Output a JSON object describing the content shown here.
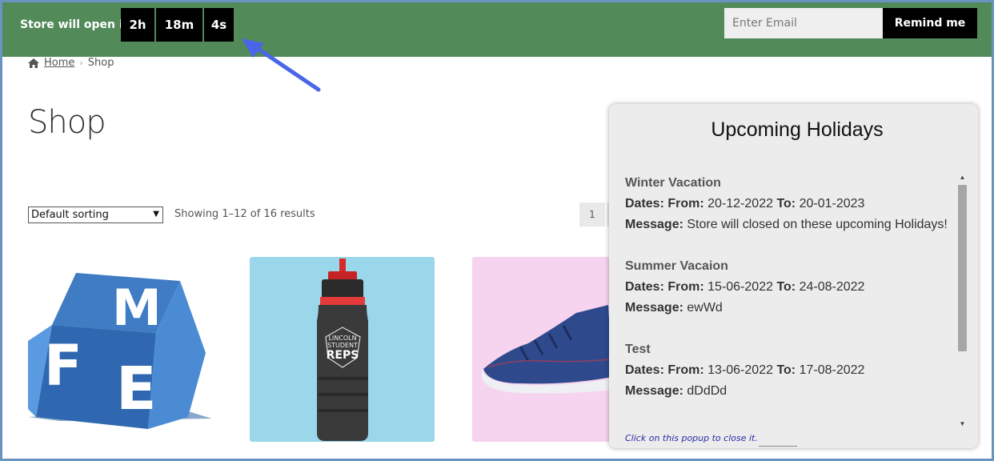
{
  "topbar": {
    "countdown_label": "Store will open in",
    "hours": "2h",
    "minutes": "18m",
    "seconds": "4s",
    "email_placeholder": "Enter Email",
    "remind_label": "Remind me",
    "bg_color": "#528a59"
  },
  "breadcrumb": {
    "home": "Home",
    "current": "Shop"
  },
  "page": {
    "title": "Shop",
    "sort_selected": "Default sorting",
    "results_text": "Showing 1–12 of 16 results",
    "page_number": "1"
  },
  "products": [
    {
      "icon": "fme-logo-cube"
    },
    {
      "icon": "water-bottle",
      "text_1": "LINCOLN",
      "text_2": "STUDENT",
      "text_3": "REPS"
    },
    {
      "icon": "sneaker"
    }
  ],
  "popup": {
    "title": "Upcoming Holidays",
    "dates_label": "Dates:",
    "from_label": "From:",
    "to_label": "To:",
    "message_label": "Message:",
    "holidays": [
      {
        "name": "Winter Vacation",
        "from": "20-12-2022",
        "to": "20-01-2023",
        "message": "Store will closed on these upcoming Holidays!"
      },
      {
        "name": "Summer Vacaion",
        "from": "15-06-2022",
        "to": "24-08-2022",
        "message": "ewWd"
      },
      {
        "name": "Test",
        "from": "13-06-2022",
        "to": "17-08-2022",
        "message": "dDdDd"
      }
    ],
    "close_hint": "Click on this popup to close it."
  }
}
